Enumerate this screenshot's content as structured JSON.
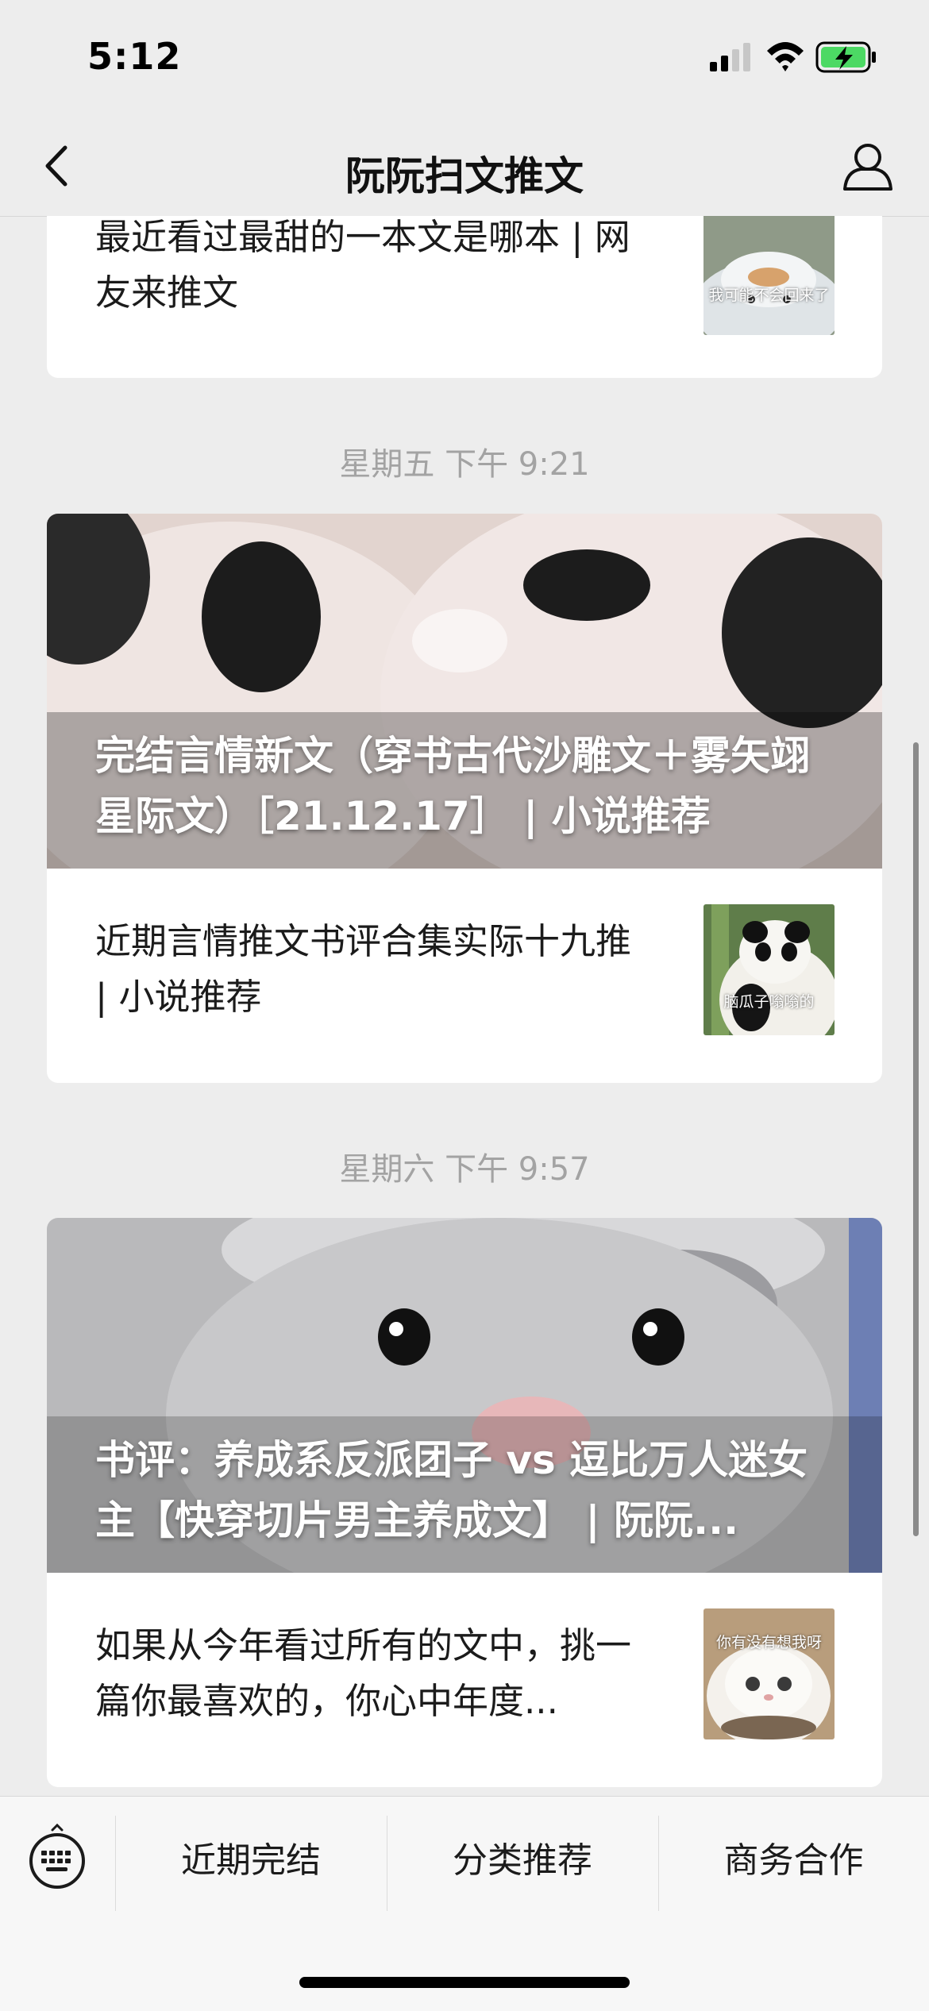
{
  "status_bar": {
    "time": "5:12",
    "battery": "charging"
  },
  "nav": {
    "title": "阮阮扫文推文",
    "back_icon": "chevron-left-icon",
    "profile_icon": "person-icon"
  },
  "feed": {
    "card0": {
      "row_text": "最近看过最甜的一本文是哪本 | 网友来推文",
      "thumb_caption": "我可能不会回来了"
    },
    "timestamp1": "星期五 下午 9:21",
    "card1": {
      "cover_title": "完结言情新文（穿书古代沙雕文＋雾矢翊星际文）［21.12.17］ | 小说推荐",
      "row_text": "近期言情推文书评合集实际十九推 | 小说推荐",
      "thumb_caption": "脑瓜子嗡嗡的"
    },
    "timestamp2": "星期六 下午 9:57",
    "card2": {
      "cover_title": "书评：养成系反派团子 vs 逗比万人迷女主【快穿切片男主养成文】 | 阮阮...",
      "row_text": "如果从今年看过所有的文中，挑一篇你最喜欢的，你心中年度...",
      "thumb_caption": "你有没有想我呀"
    }
  },
  "menu": {
    "keyboard_icon": "keyboard-icon",
    "items": [
      "近期完结",
      "分类推荐",
      "商务合作"
    ]
  }
}
